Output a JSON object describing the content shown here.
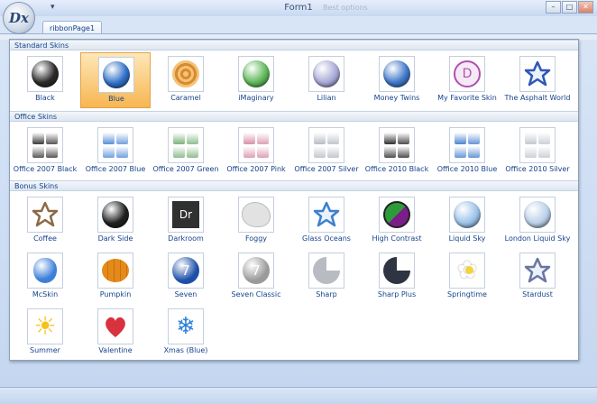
{
  "window": {
    "title": "Form1",
    "faded_hint": "Best options",
    "app_letters": "Dx",
    "qat_glyph": "▾",
    "controls": {
      "minimize": "–",
      "maximize": "□",
      "close": "✕"
    }
  },
  "ribbon": {
    "tabs": [
      {
        "label": "ribbonPage1"
      }
    ]
  },
  "gallery": {
    "groups": [
      {
        "label": "Standard Skins",
        "items": [
          {
            "label": "Black",
            "icon": "black-sphere-icon",
            "color": "#2a2a2a"
          },
          {
            "label": "Blue",
            "icon": "blue-sphere-icon",
            "color": "#2f6fc8",
            "selected": true
          },
          {
            "label": "Caramel",
            "icon": "caramel-swirl-icon",
            "color": "#d98a2b"
          },
          {
            "label": "iMaginary",
            "icon": "green-sphere-icon",
            "color": "#5fb85a"
          },
          {
            "label": "Lilian",
            "icon": "lilian-sphere-icon",
            "color": "#a9a9d8"
          },
          {
            "label": "Money Twins",
            "icon": "money-twins-sphere-icon",
            "color": "#3f78c9"
          },
          {
            "label": "My Favorite Skin",
            "icon": "favorite-skin-icon",
            "color": "#b050b0"
          },
          {
            "label": "The Asphalt World",
            "icon": "star-outline-icon",
            "color": "#2e58b8"
          }
        ]
      },
      {
        "label": "Office Skins",
        "items": [
          {
            "label": "Office 2007 Black",
            "icon": "office-2007-black-icon",
            "color": "#3a3a3a"
          },
          {
            "label": "Office 2007 Blue",
            "icon": "office-2007-blue-icon",
            "color": "#5a8fd8"
          },
          {
            "label": "Office 2007 Green",
            "icon": "office-2007-green-icon",
            "color": "#7cb27c"
          },
          {
            "label": "Office 2007 Pink",
            "icon": "office-2007-pink-icon",
            "color": "#d890a8"
          },
          {
            "label": "Office 2007 Silver",
            "icon": "office-2007-silver-icon",
            "color": "#b8bcc4"
          },
          {
            "label": "Office 2010 Black",
            "icon": "office-2010-black-icon",
            "color": "#2f2f2f"
          },
          {
            "label": "Office 2010 Blue",
            "icon": "office-2010-blue-icon",
            "color": "#4c84d0"
          },
          {
            "label": "Office 2010 Silver",
            "icon": "office-2010-silver-icon",
            "color": "#c4c8d0"
          }
        ]
      },
      {
        "label": "Bonus Skins",
        "items": [
          {
            "label": "Coffee",
            "icon": "coffee-star-icon",
            "color": "#8a6a45"
          },
          {
            "label": "Dark Side",
            "icon": "dark-side-sphere-icon",
            "color": "#202020"
          },
          {
            "label": "Darkroom",
            "icon": "darkroom-icon",
            "color": "#303030",
            "text": "Dr"
          },
          {
            "label": "Foggy",
            "icon": "foggy-cloud-icon",
            "color": "#e2e2e2"
          },
          {
            "label": "Glass Oceans",
            "icon": "glass-oceans-star-icon",
            "color": "#3d7fd0"
          },
          {
            "label": "High Contrast",
            "icon": "high-contrast-icon",
            "color": "#7a1f8a"
          },
          {
            "label": "Liquid Sky",
            "icon": "liquid-sky-sphere-icon",
            "color": "#9cc3ea"
          },
          {
            "label": "London Liquid Sky",
            "icon": "london-liquid-sky-sphere-icon",
            "color": "#b9d0e9"
          },
          {
            "label": "McSkin",
            "icon": "apple-icon",
            "color": "#3b7fd8"
          },
          {
            "label": "Pumpkin",
            "icon": "pumpkin-icon",
            "color": "#e58a1a"
          },
          {
            "label": "Seven",
            "icon": "seven-icon",
            "color": "#1d4fa8",
            "text": "7"
          },
          {
            "label": "Seven Classic",
            "icon": "seven-classic-icon",
            "color": "#9a9a9a",
            "text": "7"
          },
          {
            "label": "Sharp",
            "icon": "sharp-pie-icon",
            "color": "#b8bcc2"
          },
          {
            "label": "Sharp Plus",
            "icon": "sharp-plus-pie-icon",
            "color": "#2e3442"
          },
          {
            "label": "Springtime",
            "icon": "daisy-flower-icon",
            "color": "#f4d23a"
          },
          {
            "label": "Stardust",
            "icon": "stardust-star-icon",
            "color": "#6a76a0"
          },
          {
            "label": "Summer",
            "icon": "sun-icon",
            "color": "#f5c21b"
          },
          {
            "label": "Valentine",
            "icon": "heart-icon",
            "color": "#d8323f"
          },
          {
            "label": "Xmas (Blue)",
            "icon": "snowflake-icon",
            "color": "#2c7fd6"
          }
        ]
      }
    ]
  }
}
